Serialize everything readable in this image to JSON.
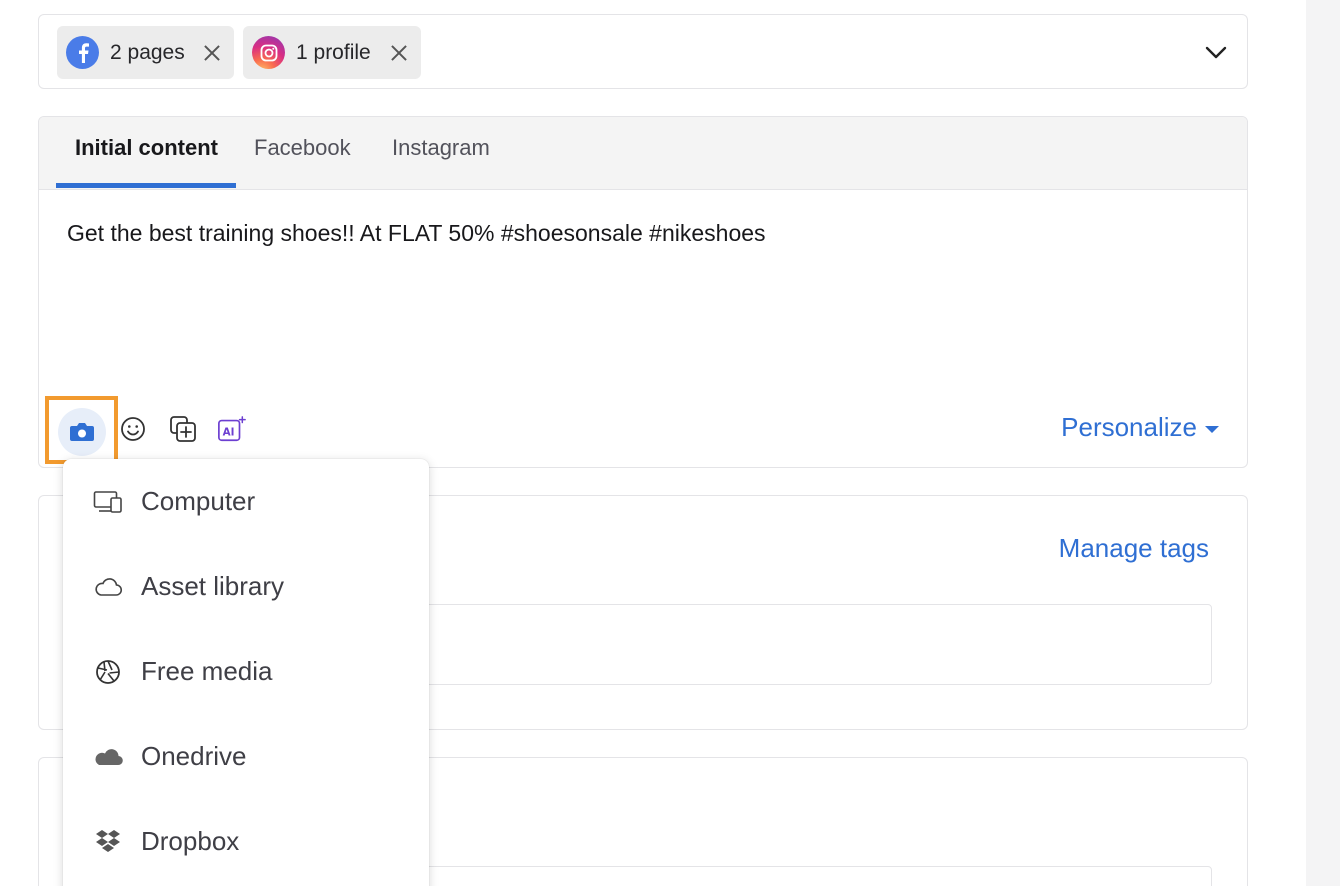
{
  "profiles": {
    "chips": [
      {
        "label": "2 pages",
        "network": "facebook",
        "icon": "facebook-icon"
      },
      {
        "label": "1 profile",
        "network": "instagram",
        "icon": "instagram-icon"
      }
    ]
  },
  "composer": {
    "tabs": [
      {
        "label": "Initial content",
        "active": true
      },
      {
        "label": "Facebook",
        "active": false
      },
      {
        "label": "Instagram",
        "active": false
      }
    ],
    "post_text": "Get the best training shoes!! At FLAT 50% #shoesonsale #nikeshoes",
    "toolbar": {
      "icons": [
        "camera-icon",
        "emoji-icon",
        "add-content-icon",
        "ai-assistant-icon"
      ],
      "personalize_label": "Personalize"
    }
  },
  "tags": {
    "manage_label": "Manage tags"
  },
  "media_menu": {
    "items": [
      {
        "label": "Computer",
        "icon": "computer-icon"
      },
      {
        "label": "Asset library",
        "icon": "cloud-icon"
      },
      {
        "label": "Free media",
        "icon": "aperture-icon"
      },
      {
        "label": "Onedrive",
        "icon": "onedrive-icon"
      },
      {
        "label": "Dropbox",
        "icon": "dropbox-icon"
      }
    ]
  },
  "colors": {
    "accent": "#2f6fd3",
    "highlight": "#f29a2e",
    "facebook": "#4a7ce8"
  }
}
